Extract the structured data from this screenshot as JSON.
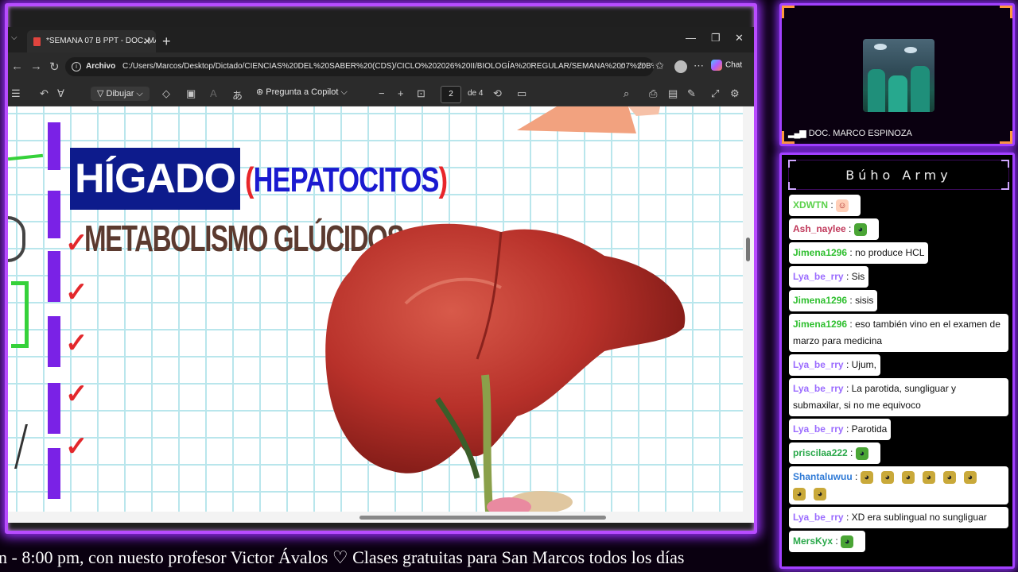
{
  "browser": {
    "tab_title": "*SEMANA 07 B PPT - DOC. MARCO",
    "address_prefix": "Archivo",
    "address_url": "C:/Users/Marcos/Desktop/Dictado/CIENCIAS%20DEL%20SABER%20(CDS)/CICLO%202026%20II/BIOLOGÍA%20REGULAR/SEMANA%2007%20B%20...",
    "chat_label": "Chat"
  },
  "pdf_toolbar": {
    "draw_label": "Dibujar",
    "copilot_label": "Pregunta a Copilot",
    "page_current": "2",
    "page_total_label": "de 4"
  },
  "slide": {
    "title": "HÍGADO",
    "title_paren_open": "(",
    "subtitle": "HEPATOCITOS",
    "title_paren_close": ")",
    "line1": "METABOLISMO GLÚCIDOS",
    "check_symbol": "✓"
  },
  "webcam": {
    "name": "DOC. MARCO ESPINOZA"
  },
  "chat": {
    "title": "Búho Army",
    "messages": [
      {
        "user": "XDWTN",
        "text": "",
        "color": "#5ad14a",
        "emote": "face"
      },
      {
        "user": "Ash_naylee",
        "text": "",
        "color": "#c0385a",
        "emote": "pepe"
      },
      {
        "user": "Jimena1296",
        "text": "no produce HCL",
        "color": "#2fbf2f",
        "emote": ""
      },
      {
        "user": "Lya_be_rry",
        "text": "Sis",
        "color": "#9b6cff",
        "emote": ""
      },
      {
        "user": "Jimena1296",
        "text": "sisis",
        "color": "#2fbf2f",
        "emote": ""
      },
      {
        "user": "Jimena1296",
        "text": "eso también vino en el examen de marzo para medicina",
        "color": "#2fbf2f",
        "emote": ""
      },
      {
        "user": "Lya_be_rry",
        "text": "Ujum,",
        "color": "#9b6cff",
        "emote": ""
      },
      {
        "user": "Lya_be_rry",
        "text": "La parotida, sungliguar y submaxilar, si no me equivoco",
        "color": "#9b6cff",
        "emote": ""
      },
      {
        "user": "Lya_be_rry",
        "text": "Parotida",
        "color": "#9b6cff",
        "emote": ""
      },
      {
        "user": "priscilaa222",
        "text": "",
        "color": "#2aa84a",
        "emote": "pepe"
      },
      {
        "user": "Shantaluwuu",
        "text": "",
        "color": "#2f7ad6",
        "emote": "frogs"
      },
      {
        "user": "Lya_be_rry",
        "text": "XD era sublingual no sungliguar",
        "color": "#9b6cff",
        "emote": ""
      },
      {
        "user": "MersKyx",
        "text": "",
        "color": "#2aa84a",
        "emote": "pepe"
      }
    ]
  },
  "ticker": {
    "text": "n - 8:00 pm, con nuesto profesor Victor Ávalos  ♡  Clases gratuitas para San Marcos todos los días"
  },
  "colors": {
    "frame_glow": "#b84cff",
    "title_bg": "#0d1b8c",
    "check_red": "#e2282c",
    "liver": "#b8312a"
  }
}
